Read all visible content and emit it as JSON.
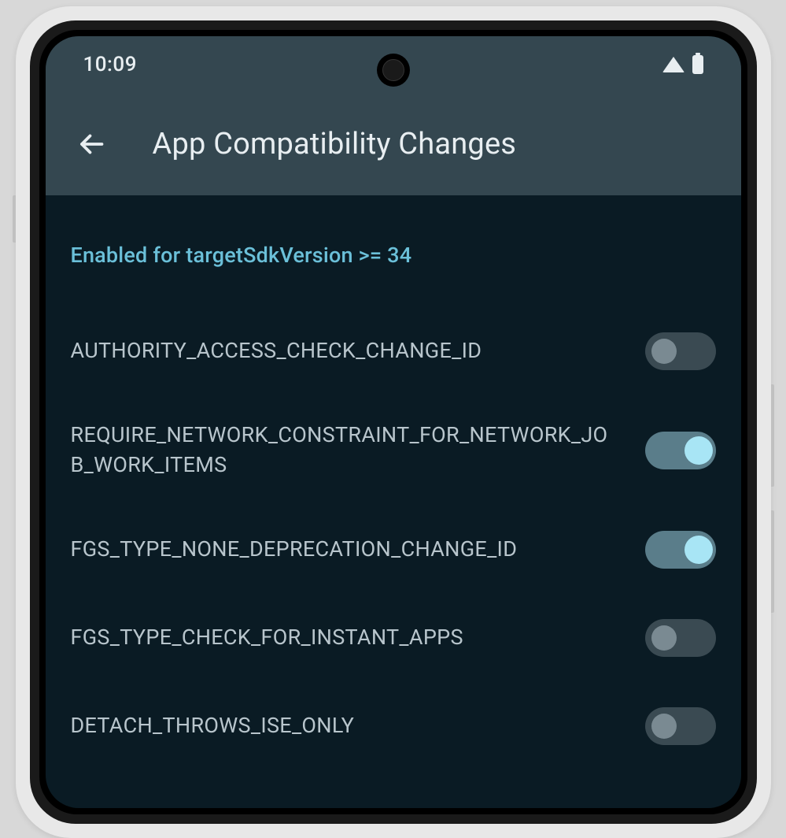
{
  "statusBar": {
    "time": "10:09"
  },
  "appBar": {
    "title": "App Compatibility Changes"
  },
  "content": {
    "sectionHeader": "Enabled for targetSdkVersion >= 34",
    "settings": [
      {
        "label": "AUTHORITY_ACCESS_CHECK_CHANGE_ID",
        "enabled": false
      },
      {
        "label": "REQUIRE_NETWORK_CONSTRAINT_FOR_NETWORK_JOB_WORK_ITEMS",
        "enabled": true
      },
      {
        "label": "FGS_TYPE_NONE_DEPRECATION_CHANGE_ID",
        "enabled": true
      },
      {
        "label": "FGS_TYPE_CHECK_FOR_INSTANT_APPS",
        "enabled": false
      },
      {
        "label": "DETACH_THROWS_ISE_ONLY",
        "enabled": false
      }
    ]
  }
}
